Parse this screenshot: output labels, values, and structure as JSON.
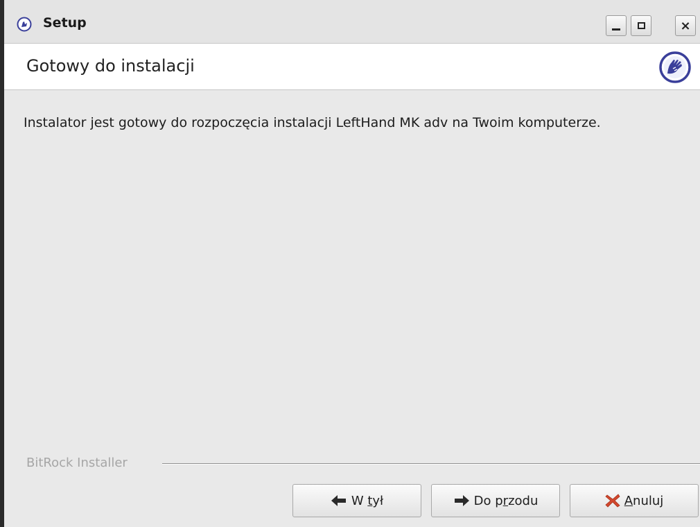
{
  "window": {
    "title": "Setup",
    "controls": {
      "minimize": "minimize",
      "maximize": "maximize",
      "close": "×"
    }
  },
  "header": {
    "title": "Gotowy do instalacji",
    "logo_icon": "bitrock-hand-logo-icon"
  },
  "main": {
    "message": "Instalator jest gotowy do rozpoczęcia instalacji LeftHand MK adv na Twoim komputerze."
  },
  "footer": {
    "brand": "BitRock Installer"
  },
  "buttons": {
    "back": {
      "pre": "W ",
      "mnemonic": "t",
      "post": "ył",
      "icon": "arrow-left-icon"
    },
    "next": {
      "pre": "Do p",
      "mnemonic": "r",
      "post": "zodu",
      "icon": "arrow-right-icon"
    },
    "cancel": {
      "pre": "",
      "mnemonic": "A",
      "post": "nuluj",
      "icon": "cancel-x-icon"
    }
  },
  "colors": {
    "logo_blue": "#3a3f9a",
    "cancel_red": "#d2482e"
  }
}
